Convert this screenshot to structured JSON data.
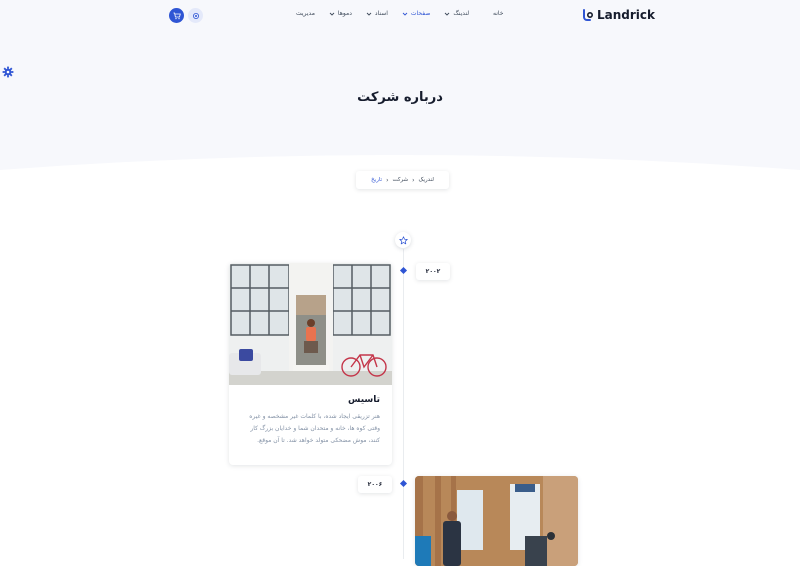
{
  "brand": {
    "name": "Landrick"
  },
  "nav": {
    "items": [
      {
        "label": "مدیریت",
        "has_dropdown": false,
        "active": false
      },
      {
        "label": "دموها",
        "has_dropdown": true,
        "active": false
      },
      {
        "label": "اسناد",
        "has_dropdown": true,
        "active": false
      },
      {
        "label": "صفحات",
        "has_dropdown": true,
        "active": true
      },
      {
        "label": "لندینگ",
        "has_dropdown": true,
        "active": false
      },
      {
        "label": "خانه",
        "has_dropdown": false,
        "active": false
      }
    ]
  },
  "hero": {
    "title": "درباره شرکت"
  },
  "breadcrumb": {
    "items": [
      "تاریخ",
      "شرکت",
      "لندریک"
    ]
  },
  "timeline": {
    "entries": [
      {
        "year": "۲۰۰۲",
        "title": "تاسیس",
        "text": "هنر تزریقی ایجاد شده، با کلمات غیر مشخصه و غیره وقتی کوه ها، خانه و متحدان شما و خدایان بزرگ کار کنند، موش مضحکی متولد خواهد شد. تا آن موقع."
      },
      {
        "year": "۲۰۰۶",
        "title": "",
        "text": ""
      }
    ]
  },
  "colors": {
    "accent": "#2f55d4",
    "hero_bg": "#f7f8fc",
    "heading": "#161c2d",
    "muted": "#8492a6"
  },
  "icons": {
    "cart": "cart-icon",
    "settings": "settings-icon",
    "star": "star-icon",
    "side_gear": "gear-icon"
  }
}
